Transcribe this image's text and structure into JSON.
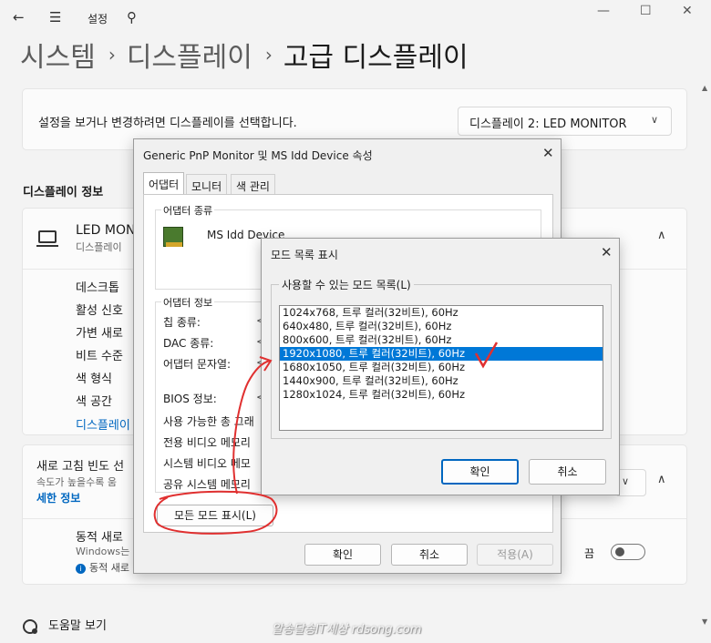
{
  "window": {
    "title": "설정",
    "controls": {
      "minimize": "—",
      "maximize": "☐",
      "close": "✕"
    }
  },
  "breadcrumb": {
    "level1": "시스템",
    "level2": "디스플레이",
    "current": "고급 디스플레이",
    "separator": "›"
  },
  "display_select": {
    "prompt": "설정을 보거나 변경하려면 디스플레이를 선택합니다.",
    "selected": "디스플레이 2: LED MONITOR"
  },
  "display_info": {
    "section_title": "디스플레이 정보",
    "monitor_name": "LED MON",
    "monitor_sub": "디스플레이",
    "props": [
      "데스크톱",
      "활성 신호",
      "가변 새로",
      "비트 수준",
      "색 형식",
      "색 공간"
    ],
    "adapter_link": "디스플레이"
  },
  "refresh": {
    "title": "새로 고침 빈도 선",
    "desc": "속도가 높을수록 움",
    "more_link": "세한 정보",
    "dynamic_title": "동적 새로",
    "dynamic_sub": "Windows는",
    "dynamic_info": "동적 새로",
    "toggle_label": "끔",
    "toggle_on": false
  },
  "help": {
    "label": "도움말 보기"
  },
  "watermark": "알송달송IT세상 rdsong.com",
  "properties_dialog": {
    "title": "Generic PnP Monitor 및 MS Idd Device 속성",
    "tabs": [
      "어댑터",
      "모니터",
      "색 관리"
    ],
    "active_tab": 0,
    "adapter_type_label": "어댑터 종류",
    "adapter_type": "MS Idd Device",
    "adapter_info_label": "어댑터 정보",
    "info_rows": [
      {
        "label": "칩 종류:",
        "value": "<"
      },
      {
        "label": "DAC 종류:",
        "value": "<"
      },
      {
        "label": "어댑터 문자열:",
        "value": "<"
      },
      {
        "label": "BIOS 정보:",
        "value": "<"
      },
      {
        "label": "사용 가능한 총 그래",
        "value": ""
      },
      {
        "label": "전용 비디오 메모리",
        "value": ""
      },
      {
        "label": "시스템 비디오 메모",
        "value": ""
      },
      {
        "label": "공유 시스템 메모리",
        "value": ""
      }
    ],
    "list_modes_button": "모든 모드 표시(L)",
    "ok": "확인",
    "cancel": "취소",
    "apply": "적용(A)"
  },
  "mode_dialog": {
    "title": "모드 목록 표시",
    "group_label": "사용할 수 있는 모드 목록(L)",
    "modes": [
      "1024x768, 트루 컬러(32비트), 60Hz",
      "640x480, 트루 컬러(32비트), 60Hz",
      "800x600, 트루 컬러(32비트), 60Hz",
      "1920x1080, 트루 컬러(32비트), 60Hz",
      "1680x1050, 트루 컬러(32비트), 60Hz",
      "1440x900, 트루 컬러(32비트), 60Hz",
      "1280x1024, 트루 컬러(32비트), 60Hz"
    ],
    "selected_index": 3,
    "ok": "확인",
    "cancel": "취소"
  },
  "colors": {
    "accent": "#0067c0",
    "selection": "#0078d7",
    "annotation": "#e03030"
  }
}
